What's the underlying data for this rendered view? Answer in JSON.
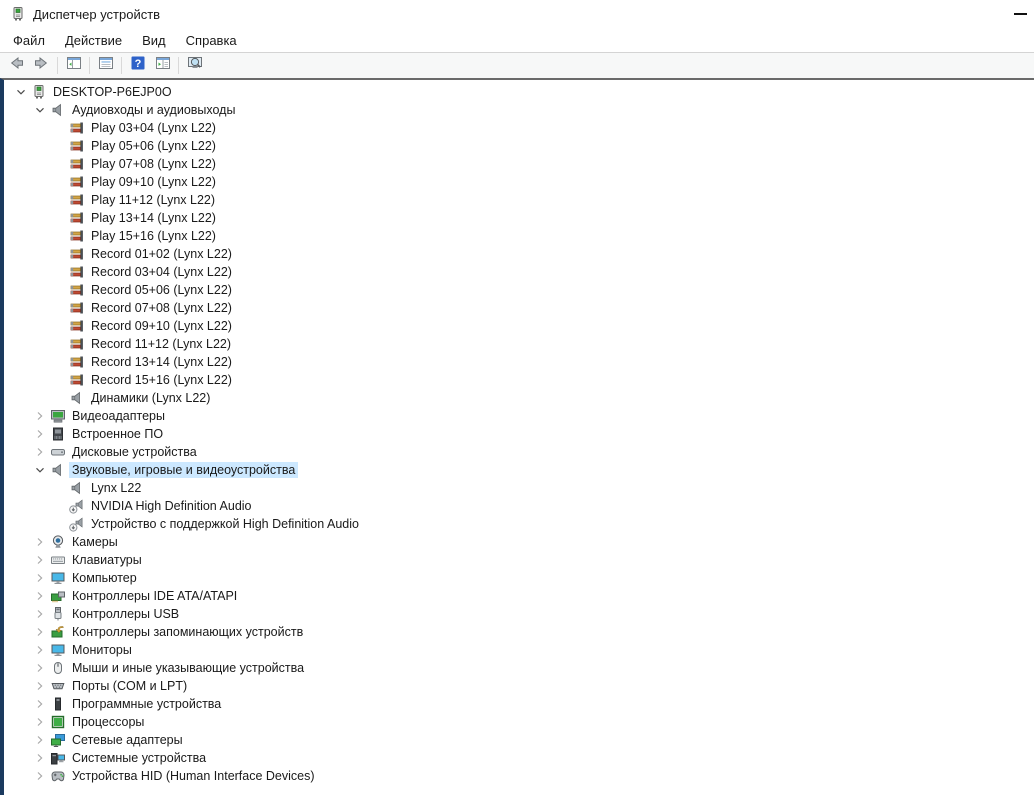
{
  "window": {
    "title": "Диспетчер устройств",
    "app_icon": "device-manager-icon",
    "minimize_glyph": "—"
  },
  "colors": {
    "selection_highlight": "#cce8ff",
    "frame_accent": "#1b3a5f",
    "toolbar_border": "#6a6a6a",
    "help_blue": "#2e62c9"
  },
  "menu": {
    "items": [
      {
        "id": "file",
        "label": "Файл"
      },
      {
        "id": "action",
        "label": "Действие"
      },
      {
        "id": "view",
        "label": "Вид"
      },
      {
        "id": "help",
        "label": "Справка"
      }
    ]
  },
  "toolbar": {
    "buttons": [
      {
        "id": "back",
        "icon": "back-arrow-icon",
        "enabled": false
      },
      {
        "id": "forward",
        "icon": "forward-arrow-icon",
        "enabled": false
      },
      {
        "id": "show-console-tree",
        "icon": "console-tree-icon",
        "enabled": true
      },
      {
        "id": "properties",
        "icon": "properties-icon",
        "enabled": true
      },
      {
        "id": "help",
        "icon": "help-icon",
        "enabled": true
      },
      {
        "id": "show-action-pane",
        "icon": "action-pane-icon",
        "enabled": true
      },
      {
        "id": "scan-hardware-changes",
        "icon": "scan-computer-icon",
        "enabled": true
      }
    ]
  },
  "tree": {
    "items": [
      {
        "label": "DESKTOP-P6EJP0O",
        "icon": "computer",
        "level": 0,
        "state": "expanded",
        "selected": false
      },
      {
        "label": "Аудиовходы и аудиовыходы",
        "icon": "speaker",
        "level": 1,
        "state": "expanded",
        "selected": false
      },
      {
        "label": "Play 03+04 (Lynx L22)",
        "icon": "audio-endpoint",
        "level": 2,
        "state": "none",
        "selected": false
      },
      {
        "label": "Play 05+06 (Lynx L22)",
        "icon": "audio-endpoint",
        "level": 2,
        "state": "none",
        "selected": false
      },
      {
        "label": "Play 07+08 (Lynx L22)",
        "icon": "audio-endpoint",
        "level": 2,
        "state": "none",
        "selected": false
      },
      {
        "label": "Play 09+10 (Lynx L22)",
        "icon": "audio-endpoint",
        "level": 2,
        "state": "none",
        "selected": false
      },
      {
        "label": "Play 11+12 (Lynx L22)",
        "icon": "audio-endpoint",
        "level": 2,
        "state": "none",
        "selected": false
      },
      {
        "label": "Play 13+14 (Lynx L22)",
        "icon": "audio-endpoint",
        "level": 2,
        "state": "none",
        "selected": false
      },
      {
        "label": "Play 15+16 (Lynx L22)",
        "icon": "audio-endpoint",
        "level": 2,
        "state": "none",
        "selected": false
      },
      {
        "label": "Record 01+02 (Lynx L22)",
        "icon": "audio-endpoint",
        "level": 2,
        "state": "none",
        "selected": false
      },
      {
        "label": "Record 03+04 (Lynx L22)",
        "icon": "audio-endpoint",
        "level": 2,
        "state": "none",
        "selected": false
      },
      {
        "label": "Record 05+06 (Lynx L22)",
        "icon": "audio-endpoint",
        "level": 2,
        "state": "none",
        "selected": false
      },
      {
        "label": "Record 07+08 (Lynx L22)",
        "icon": "audio-endpoint",
        "level": 2,
        "state": "none",
        "selected": false
      },
      {
        "label": "Record 09+10 (Lynx L22)",
        "icon": "audio-endpoint",
        "level": 2,
        "state": "none",
        "selected": false
      },
      {
        "label": "Record 11+12 (Lynx L22)",
        "icon": "audio-endpoint",
        "level": 2,
        "state": "none",
        "selected": false
      },
      {
        "label": "Record 13+14 (Lynx L22)",
        "icon": "audio-endpoint",
        "level": 2,
        "state": "none",
        "selected": false
      },
      {
        "label": "Record 15+16 (Lynx L22)",
        "icon": "audio-endpoint",
        "level": 2,
        "state": "none",
        "selected": false
      },
      {
        "label": "Динамики (Lynx L22)",
        "icon": "speaker",
        "level": 2,
        "state": "none",
        "selected": false
      },
      {
        "label": "Видеоадаптеры",
        "icon": "display-adapter",
        "level": 1,
        "state": "collapsed",
        "selected": false
      },
      {
        "label": "Встроенное ПО",
        "icon": "firmware",
        "level": 1,
        "state": "collapsed",
        "selected": false
      },
      {
        "label": "Дисковые устройства",
        "icon": "disk-drive",
        "level": 1,
        "state": "collapsed",
        "selected": false
      },
      {
        "label": "Звуковые, игровые и видеоустройства",
        "icon": "speaker",
        "level": 1,
        "state": "expanded",
        "selected": true
      },
      {
        "label": "Lynx L22",
        "icon": "speaker",
        "level": 2,
        "state": "none",
        "selected": false
      },
      {
        "label": "NVIDIA High Definition Audio",
        "icon": "speaker-disabled",
        "level": 2,
        "state": "none",
        "selected": false
      },
      {
        "label": "Устройство с поддержкой High Definition Audio",
        "icon": "speaker-disabled",
        "level": 2,
        "state": "none",
        "selected": false
      },
      {
        "label": "Камеры",
        "icon": "camera",
        "level": 1,
        "state": "collapsed",
        "selected": false
      },
      {
        "label": "Клавиатуры",
        "icon": "keyboard",
        "level": 1,
        "state": "collapsed",
        "selected": false
      },
      {
        "label": "Компьютер",
        "icon": "monitor",
        "level": 1,
        "state": "collapsed",
        "selected": false
      },
      {
        "label": "Контроллеры IDE ATA/ATAPI",
        "icon": "ide-controller",
        "level": 1,
        "state": "collapsed",
        "selected": false
      },
      {
        "label": "Контроллеры USB",
        "icon": "usb",
        "level": 1,
        "state": "collapsed",
        "selected": false
      },
      {
        "label": "Контроллеры запоминающих устройств",
        "icon": "storage-controller",
        "level": 1,
        "state": "collapsed",
        "selected": false
      },
      {
        "label": "Мониторы",
        "icon": "monitor",
        "level": 1,
        "state": "collapsed",
        "selected": false
      },
      {
        "label": "Мыши и иные указывающие устройства",
        "icon": "mouse",
        "level": 1,
        "state": "collapsed",
        "selected": false
      },
      {
        "label": "Порты (COM и LPT)",
        "icon": "port",
        "level": 1,
        "state": "collapsed",
        "selected": false
      },
      {
        "label": "Программные устройства",
        "icon": "software-device",
        "level": 1,
        "state": "collapsed",
        "selected": false
      },
      {
        "label": "Процессоры",
        "icon": "processor",
        "level": 1,
        "state": "collapsed",
        "selected": false
      },
      {
        "label": "Сетевые адаптеры",
        "icon": "network-adapter",
        "level": 1,
        "state": "collapsed",
        "selected": false
      },
      {
        "label": "Системные устройства",
        "icon": "system-device",
        "level": 1,
        "state": "collapsed",
        "selected": false
      },
      {
        "label": "Устройства HID (Human Interface Devices)",
        "icon": "hid",
        "level": 1,
        "state": "collapsed",
        "selected": false
      }
    ]
  }
}
